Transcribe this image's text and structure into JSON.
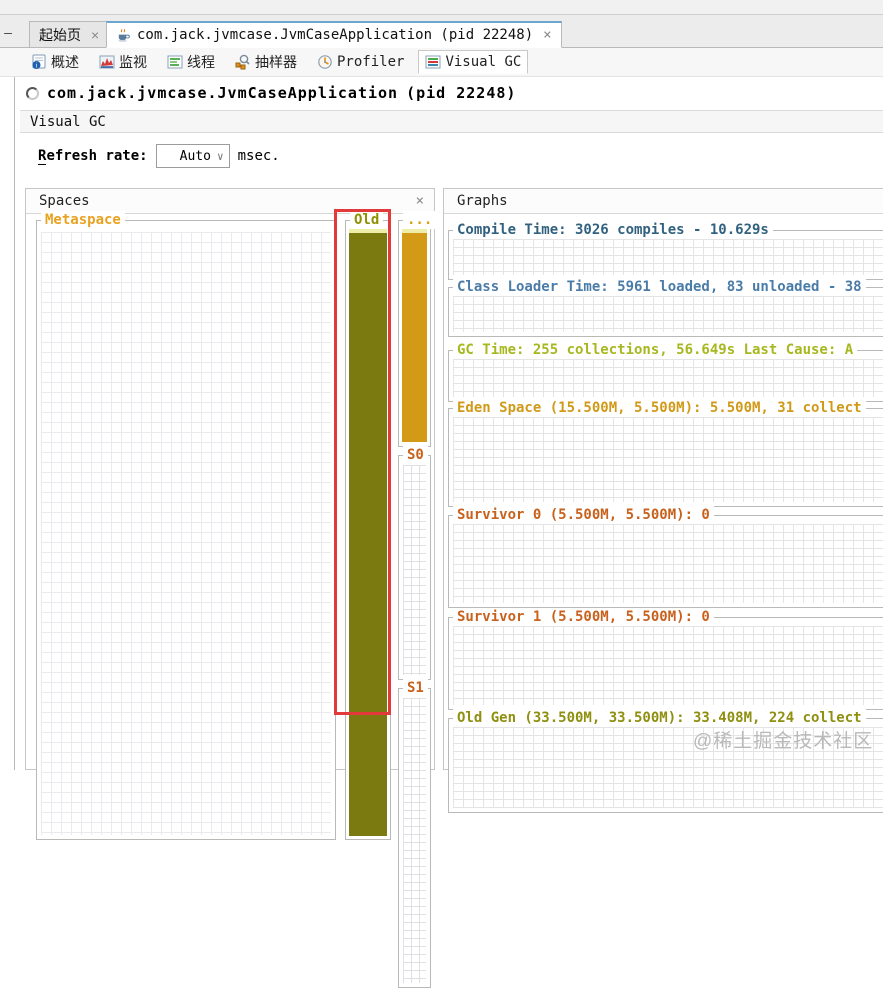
{
  "glyphs": {
    "close": "×",
    "chevron": "∨",
    "collapse": "—"
  },
  "window_tabs": [
    {
      "label": "起始页"
    },
    {
      "label": "com.jack.jvmcase.JvmCaseApplication (pid 22248)"
    }
  ],
  "toolbar": {
    "items": [
      {
        "label": "概述",
        "icon": "overview-icon"
      },
      {
        "label": "监视",
        "icon": "monitor-icon"
      },
      {
        "label": "线程",
        "icon": "threads-icon"
      },
      {
        "label": "抽样器",
        "icon": "sampler-icon"
      },
      {
        "label": "Profiler",
        "icon": "profiler-icon"
      },
      {
        "label": "Visual GC",
        "icon": "visualgc-icon"
      }
    ]
  },
  "header": {
    "title": "com.jack.jvmcase.JvmCaseApplication",
    "pid": "(pid 22248)",
    "view_bar_label": "Visual GC"
  },
  "refresh": {
    "label_first": "R",
    "label_rest": "efresh rate:",
    "value": "Auto",
    "unit": "msec."
  },
  "spaces": {
    "title": "Spaces",
    "metaspace_label": "Metaspace",
    "old_label": "Old",
    "eden_label": "...",
    "s0_label": "S0",
    "s1_label": "S1"
  },
  "graphs": {
    "title": "Graphs",
    "sections": [
      {
        "label": "Compile Time: 3026 compiles - 10.629s"
      },
      {
        "label": "Class Loader Time: 5961 loaded, 83 unloaded - 38"
      },
      {
        "label": "GC Time: 255 collections, 56.649s  Last Cause: A"
      },
      {
        "label": "Eden Space (15.500M, 5.500M): 5.500M, 31 collect"
      },
      {
        "label": "Survivor 0 (5.500M, 5.500M): 0"
      },
      {
        "label": "Survivor 1 (5.500M, 5.500M): 0"
      },
      {
        "label": "Old Gen (33.500M, 33.500M): 33.408M, 224 collect"
      }
    ]
  },
  "watermark": "@稀土掘金技术社区",
  "colors": {
    "highlight_box": "#e23a3a",
    "old_bar": "#7a7a10",
    "eden_bar": "#d29a16",
    "metaspace_label": "#e8a21f",
    "old_label": "#8f8f00",
    "survivor_label": "#c8611c",
    "compile_label": "#31617f",
    "classloader_label": "#4a7ca8",
    "gctime_label": "#a6b81e",
    "oldgen_label": "#8f8f10",
    "active_tab_accent": "#6aa6cf"
  }
}
